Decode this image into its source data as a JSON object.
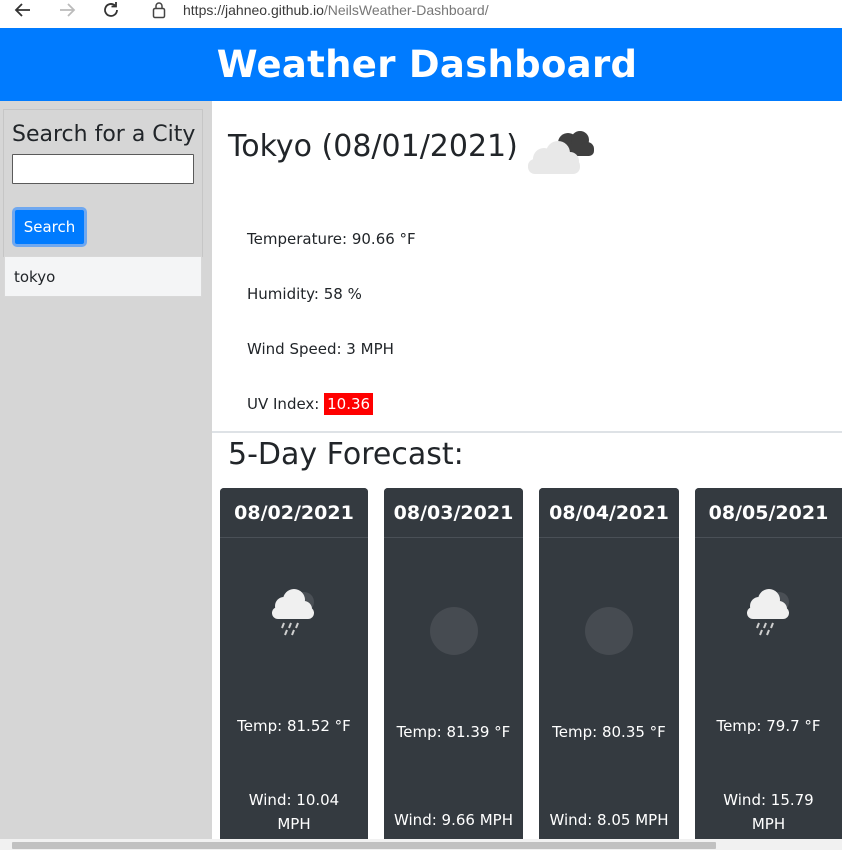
{
  "browser": {
    "url_prefix": "https://jahneo.github.io",
    "url_path": "/NeilsWeather-Dashboard/"
  },
  "header": {
    "title": "Weather Dashboard"
  },
  "sidebar": {
    "title": "Search for a City",
    "search_value": "",
    "search_button": "Search",
    "history": [
      "tokyo"
    ]
  },
  "current": {
    "title": "Tokyo (08/01/2021)",
    "icon": "broken-clouds-icon",
    "temperature": "Temperature: 90.66 °F",
    "humidity": "Humidity: 58 %",
    "wind": "Wind Speed: 3 MPH",
    "uv_label": "UV Index: ",
    "uv_value": "10.36",
    "uv_color": "#ff0000"
  },
  "forecast": {
    "title": "5-Day Forecast:",
    "days": [
      {
        "date": "08/02/2021",
        "icon": "rain-icon",
        "temp": "Temp: 81.52 °F",
        "wind": "Wind: 10.04 MPH"
      },
      {
        "date": "08/03/2021",
        "icon": "missing-icon",
        "temp": "Temp: 81.39 °F",
        "wind": "Wind: 9.66 MPH"
      },
      {
        "date": "08/04/2021",
        "icon": "missing-icon",
        "temp": "Temp: 80.35 °F",
        "wind": "Wind: 8.05 MPH"
      },
      {
        "date": "08/05/2021",
        "icon": "rain-icon",
        "temp": "Temp: 79.7 °F",
        "wind": "Wind: 15.79 MPH"
      }
    ]
  },
  "colors": {
    "brand": "#007bff",
    "card": "#343a40",
    "sidebar": "#d6d6d6"
  }
}
